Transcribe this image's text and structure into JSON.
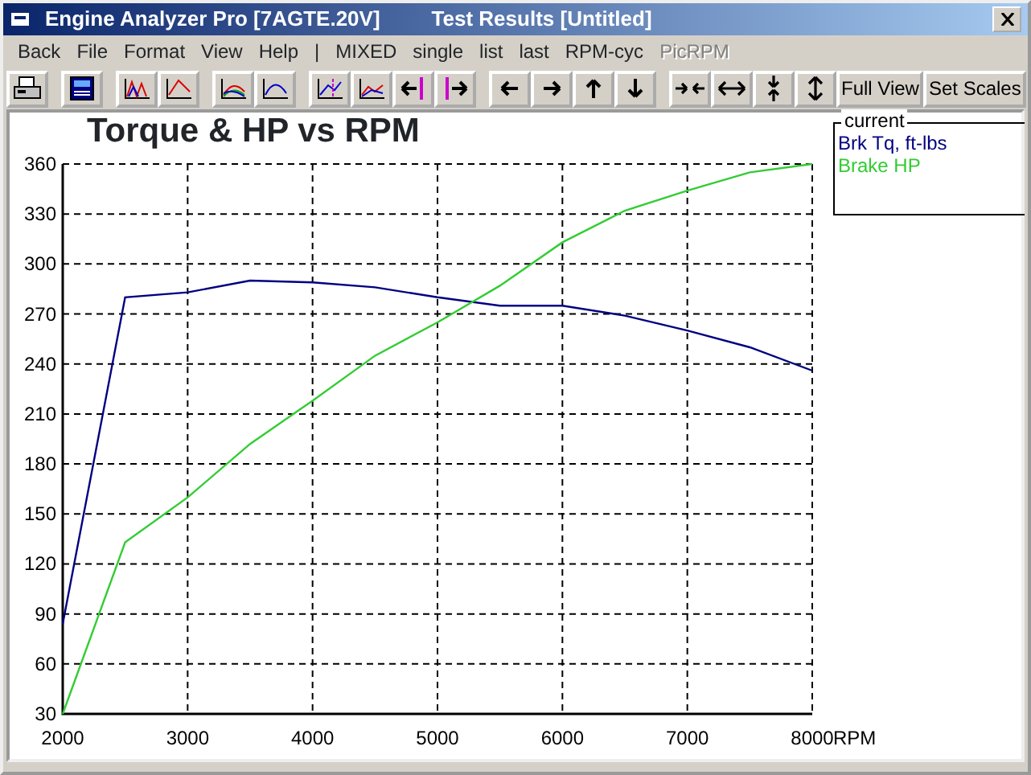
{
  "window": {
    "title": "Engine Analyzer Pro [7AGTE.20V]",
    "subtitle": "Test Results [Untitled]"
  },
  "menu": [
    {
      "label": "Back",
      "disabled": false
    },
    {
      "label": "File",
      "disabled": false
    },
    {
      "label": "Format",
      "disabled": false
    },
    {
      "label": "View",
      "disabled": false
    },
    {
      "label": "Help",
      "disabled": false
    },
    {
      "label": "|",
      "disabled": false
    },
    {
      "label": "MIXED",
      "disabled": false
    },
    {
      "label": "single",
      "disabled": false
    },
    {
      "label": "list",
      "disabled": false
    },
    {
      "label": "last",
      "disabled": false
    },
    {
      "label": "RPM-cyc",
      "disabled": false
    },
    {
      "label": "PicRPM",
      "disabled": true
    }
  ],
  "toolbar": [
    [
      {
        "kind": "icon"
      }
    ],
    [
      {
        "kind": "icon"
      }
    ],
    [
      {
        "kind": "icon"
      },
      {
        "kind": "icon"
      }
    ],
    [
      {
        "kind": "icon"
      },
      {
        "kind": "icon"
      }
    ],
    [
      {
        "kind": "icon"
      },
      {
        "kind": "icon"
      },
      {
        "kind": "icon"
      },
      {
        "kind": "icon"
      }
    ],
    [
      {
        "kind": "icon"
      },
      {
        "kind": "icon"
      },
      {
        "kind": "icon"
      },
      {
        "kind": "icon"
      }
    ],
    [
      {
        "kind": "icon"
      },
      {
        "kind": "icon"
      },
      {
        "kind": "icon"
      },
      {
        "kind": "icon"
      },
      {
        "kind": "text",
        "label": "Full View"
      },
      {
        "kind": "text",
        "label": "Set Scales"
      }
    ]
  ],
  "chart": {
    "legend_title": "current",
    "chart_data": {
      "type": "line",
      "title": "Torque & HP vs RPM",
      "xlabel": "RPM",
      "x": [
        2000,
        2500,
        3000,
        3500,
        4000,
        4500,
        5000,
        5500,
        6000,
        6500,
        7000,
        7500,
        8000
      ],
      "series": [
        {
          "name": "Brk Tq, ft-lbs",
          "color": "#000080",
          "values": [
            84,
            280,
            283,
            290,
            289,
            286,
            280,
            275,
            275,
            269,
            260,
            250,
            236
          ]
        },
        {
          "name": "Brake HP",
          "color": "#33cc33",
          "values": [
            30,
            133,
            160,
            192,
            218,
            245,
            265,
            287,
            313,
            332,
            344,
            355,
            360
          ]
        }
      ],
      "grid": true,
      "xlim": [
        2000,
        8000
      ],
      "ylim": [
        30,
        360
      ],
      "xticks": [
        2000,
        3000,
        4000,
        5000,
        6000,
        7000,
        8000
      ],
      "yticks": [
        30,
        60,
        90,
        120,
        150,
        180,
        210,
        240,
        270,
        300,
        330,
        360
      ]
    }
  }
}
